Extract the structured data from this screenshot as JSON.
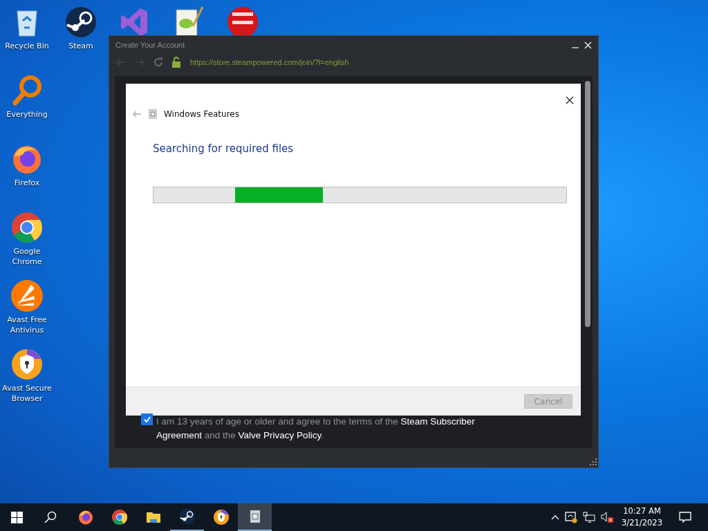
{
  "desktop": {
    "columns": [
      [
        {
          "kind": "recycle",
          "label": "Recycle Bin"
        },
        {
          "kind": "everything",
          "label": "Everything"
        },
        {
          "kind": "firefox",
          "label": "Firefox"
        },
        {
          "kind": "chrome",
          "label": "Google Chrome"
        },
        {
          "kind": "avast",
          "label": "Avast Free Antivirus"
        },
        {
          "kind": "avast-browser",
          "label": "Avast Secure Browser"
        }
      ],
      [
        {
          "kind": "steam",
          "label": "Steam"
        }
      ],
      [
        {
          "kind": "vs"
        }
      ],
      [
        {
          "kind": "notepad"
        }
      ],
      [
        {
          "kind": "devcpp"
        }
      ]
    ]
  },
  "window": {
    "title": "Create Your Account",
    "url": "https://store.steampowered.com/join/?l=english",
    "agreement": {
      "checked": true,
      "text": "I am 13 years of age or older and agree to the terms of the **Steam Subscriber Agreement** and the **Valve Privacy Policy**."
    }
  },
  "dialog": {
    "title": "Windows Features",
    "heading": "Searching for required files",
    "progress": {
      "kind": "marquee",
      "running": true
    },
    "buttons": [
      {
        "label": "Cancel",
        "disabled": true
      }
    ]
  },
  "taskbar": {
    "apps": [
      {
        "kind": "firefox",
        "running": false,
        "active": false
      },
      {
        "kind": "chrome",
        "running": false,
        "active": false
      },
      {
        "kind": "explorer",
        "running": false,
        "active": false
      },
      {
        "kind": "steam",
        "running": true,
        "active": false
      },
      {
        "kind": "avast-browser",
        "running": false,
        "active": false
      },
      {
        "kind": "features",
        "running": true,
        "active": true
      }
    ],
    "time": "10:27 AM",
    "date": "3/21/2023"
  }
}
